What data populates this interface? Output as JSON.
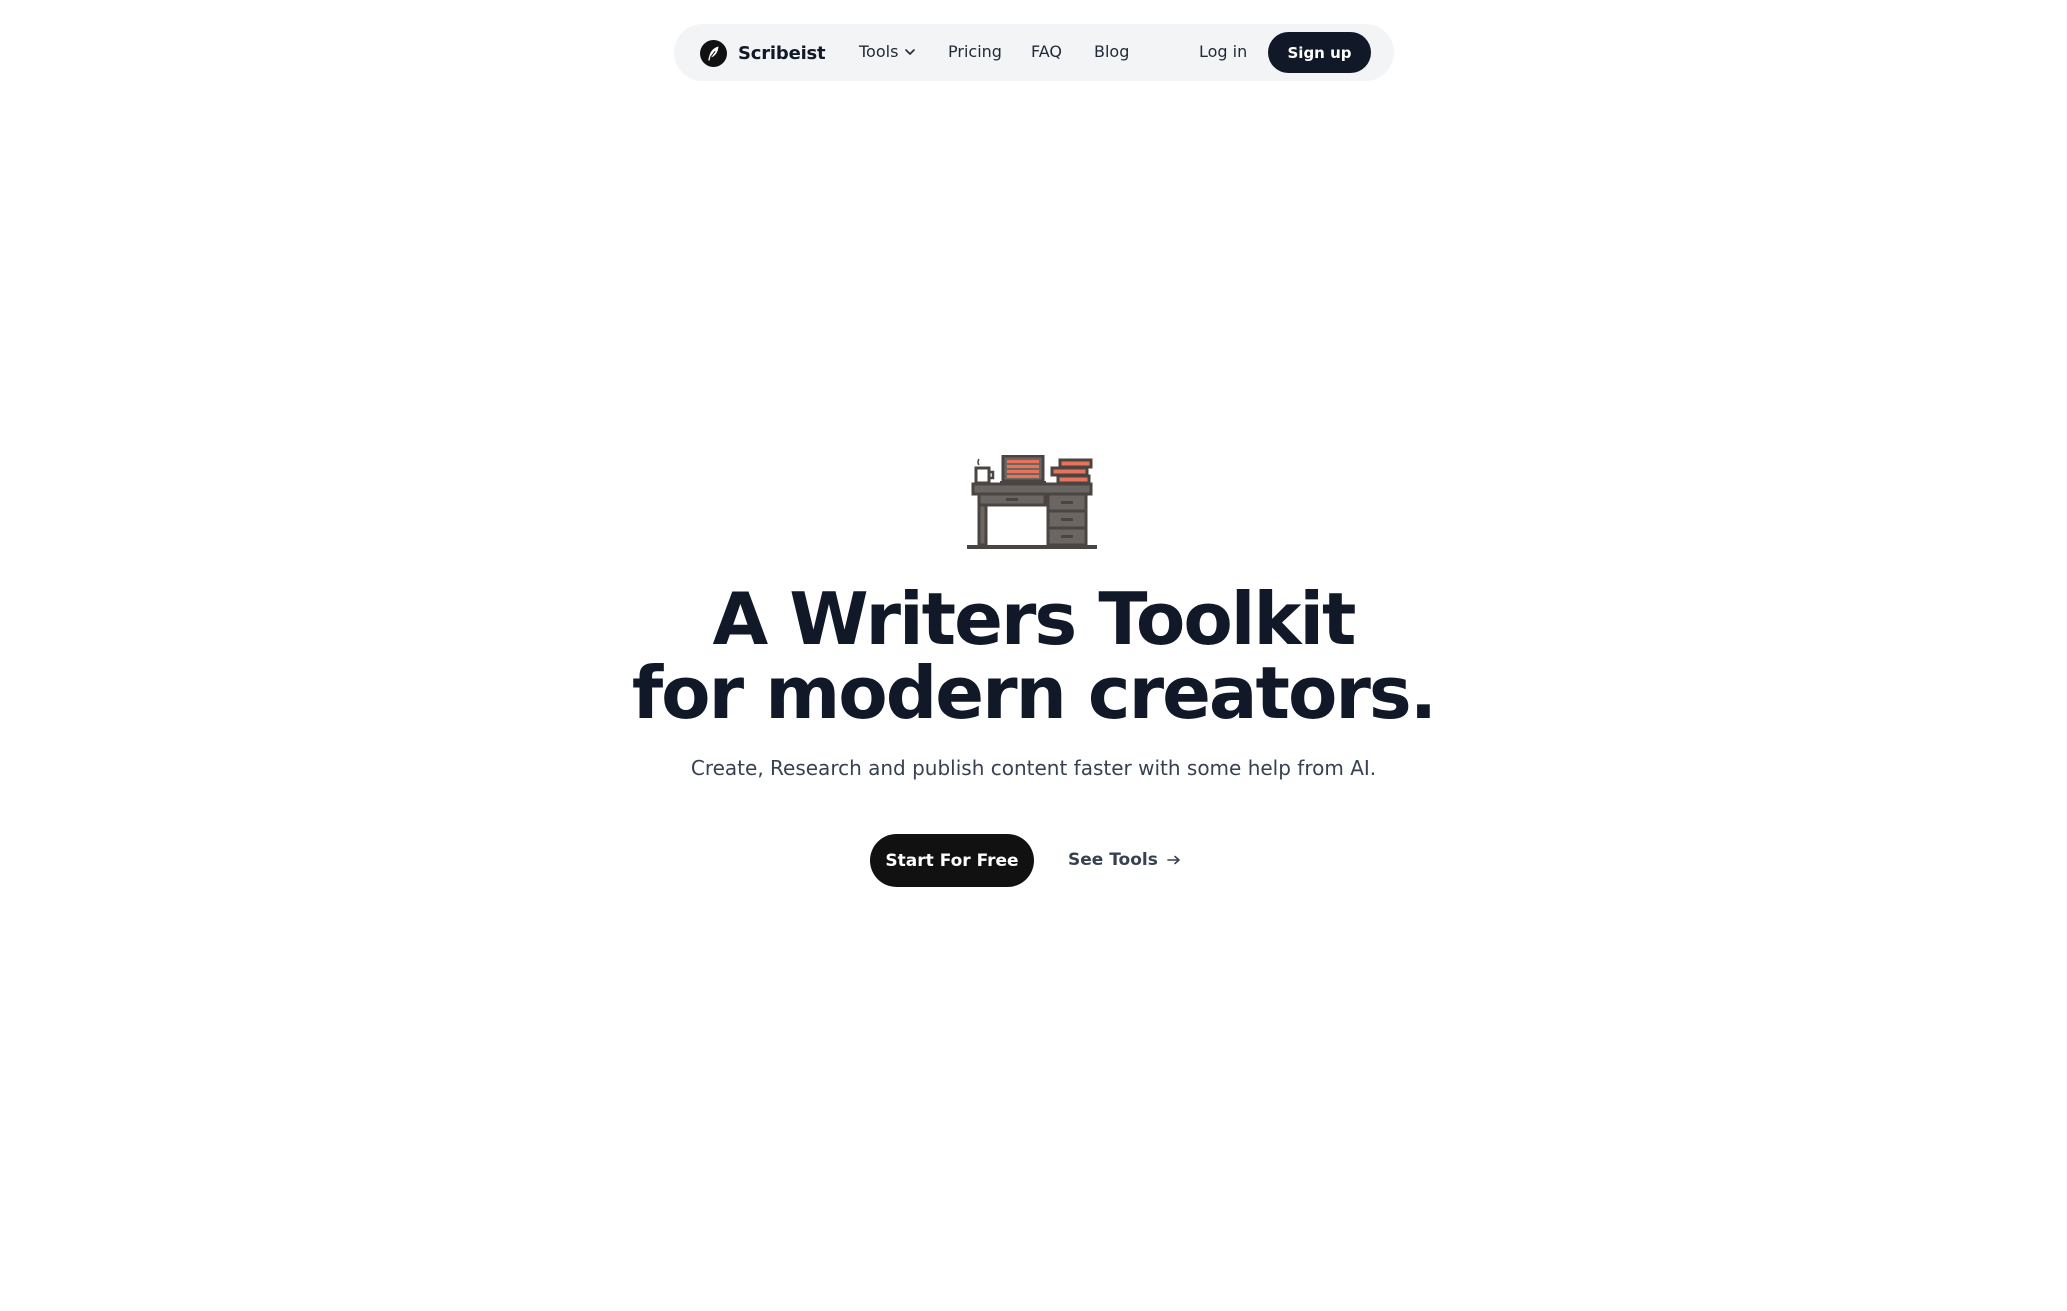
{
  "nav": {
    "brand_name": "Scribeist",
    "brand_icon": "feather-icon",
    "tools_label": "Tools",
    "pricing_label": "Pricing",
    "faq_label": "FAQ",
    "blog_label": "Blog",
    "login_label": "Log in",
    "signup_label": "Sign up"
  },
  "hero": {
    "illustration": "writing-desk-icon",
    "title_line1": "A Writers Toolkit",
    "title_line2": "for modern creators.",
    "subtitle": "Create, Research and publish content faster with some help from AI.",
    "primary_cta": "Start For Free",
    "secondary_cta": "See Tools",
    "secondary_cta_icon": "arrow-right-icon"
  },
  "colors": {
    "nav_bg": "#f3f4f6",
    "dark": "#111827",
    "text_muted": "#374151",
    "accent_orange": "#e8735a",
    "desk_gray": "#6b6661"
  }
}
